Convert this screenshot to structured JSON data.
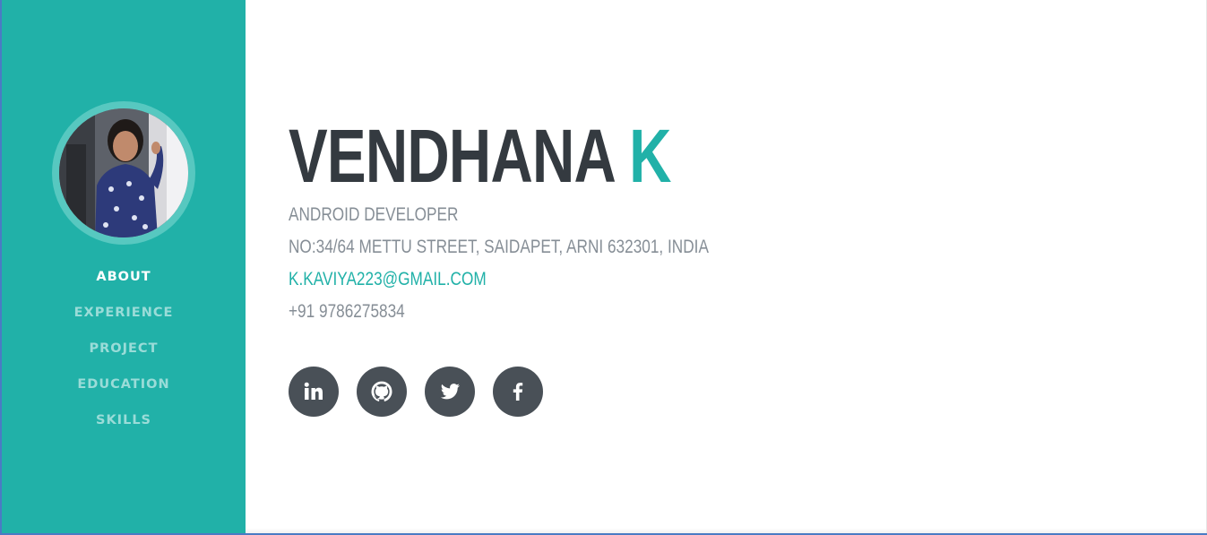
{
  "profile": {
    "first_name": "VENDHANA",
    "last_name": "K",
    "role": "ANDROID DEVELOPER",
    "address": "NO:34/64 METTU STREET, SAIDAPET, ARNI 632301, INDIA",
    "email": "K.KAVIYA223@GMAIL.COM",
    "phone": "+91 9786275834"
  },
  "nav": {
    "items": [
      {
        "label": "ABOUT",
        "active": true
      },
      {
        "label": "EXPERIENCE",
        "active": false
      },
      {
        "label": "PROJECT",
        "active": false
      },
      {
        "label": "EDUCATION",
        "active": false
      },
      {
        "label": "SKILLS",
        "active": false
      }
    ]
  },
  "socials": [
    {
      "icon": "linkedin-icon"
    },
    {
      "icon": "github-icon"
    },
    {
      "icon": "twitter-icon"
    },
    {
      "icon": "facebook-icon"
    }
  ],
  "colors": {
    "accent": "#21b1a8",
    "heading": "#343a40",
    "text_muted": "#868e96",
    "social_bg": "#495057"
  }
}
